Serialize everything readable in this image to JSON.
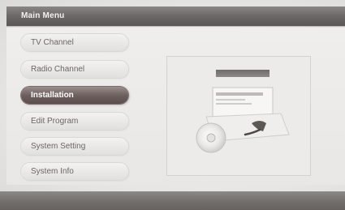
{
  "header": {
    "title": "Main Menu"
  },
  "menu": {
    "items": [
      {
        "label": "TV Channel",
        "selected": false
      },
      {
        "label": "Radio Channel",
        "selected": false
      },
      {
        "label": "Installation",
        "selected": true
      },
      {
        "label": "Edit Program",
        "selected": false
      },
      {
        "label": "System Setting",
        "selected": false
      },
      {
        "label": "System Info",
        "selected": false
      }
    ]
  },
  "preview": {
    "icon": "installation-box-with-disc-icon"
  },
  "colors": {
    "header_bar": "#6e6a69",
    "selected_item": "#6d5f5d",
    "panel": "#ecebe9",
    "item_text": "#6a6766"
  }
}
